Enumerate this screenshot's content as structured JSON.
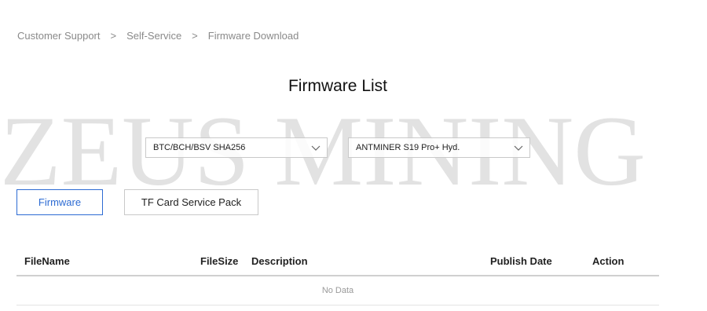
{
  "breadcrumb": {
    "items": [
      "Customer Support",
      "Self-Service",
      "Firmware Download"
    ],
    "separator": ">"
  },
  "page": {
    "title": "Firmware List"
  },
  "filters": {
    "algorithm_select": {
      "value": "BTC/BCH/BSV SHA256",
      "icon": "chevron-down-icon"
    },
    "model_select": {
      "value": "ANTMINER S19 Pro+ Hyd.",
      "icon": "chevron-down-icon"
    }
  },
  "tabs": [
    {
      "label": "Firmware",
      "active": true
    },
    {
      "label": "TF Card Service Pack",
      "active": false
    }
  ],
  "table": {
    "columns": [
      "FileName",
      "FileSize",
      "Description",
      "Publish Date",
      "Action"
    ],
    "rows": [],
    "empty_text": "No Data"
  },
  "watermark": {
    "text": "ZEUS MINING"
  },
  "colors": {
    "accent": "#2d6bd3",
    "border": "#c9c9c9",
    "muted_text": "#8a8a8a",
    "watermark": "#e2e2e2"
  }
}
